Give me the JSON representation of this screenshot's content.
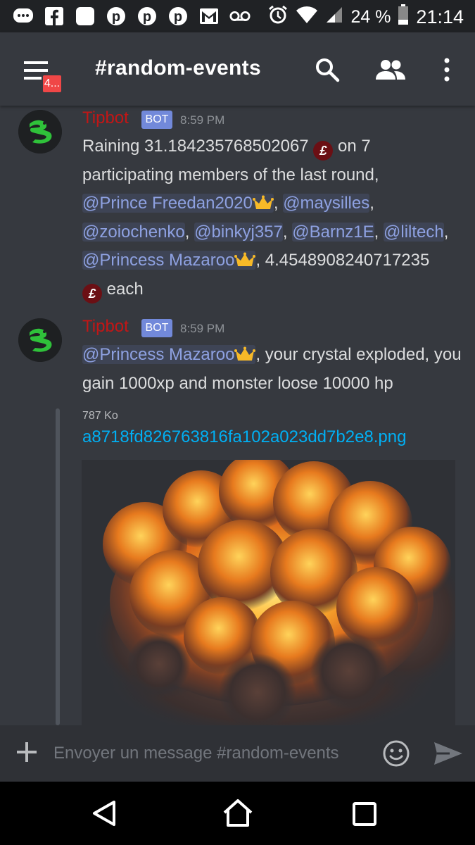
{
  "status_bar": {
    "battery": "24 %",
    "time": "21:14"
  },
  "app_bar": {
    "channel": "#random-events",
    "notification_badge": "4..."
  },
  "messages": [
    {
      "author": "Tipbot",
      "tag": "BOT",
      "time": "8:59 PM",
      "parts": {
        "p1": "Raining 31.184235768502067",
        "coin": "£",
        "p2": " on 7 participating members of the last round,",
        "m1": "@Prince Freedan2020",
        "c1": ",",
        "m2": "@maysilles",
        "c2": ",",
        "m3": "@zoiochenko",
        "c3": ",",
        "m4": "@binkyj357",
        "c4": ",",
        "m5": "@Barnz1E",
        "c5": ",",
        "m6": "@liltech",
        "c6": ",",
        "m7": "@Princess Mazaroo",
        "p3": ",  4.4548908240717235",
        "p4": " each"
      }
    },
    {
      "author": "Tipbot",
      "tag": "BOT",
      "time": "8:59 PM",
      "parts": {
        "m1": "@Princess Mazaroo",
        "p1": ", your crystal exploded, you gain 1000xp and monster loose 10000 hp"
      },
      "attachment": {
        "size": "787 Ko",
        "filename": "a8718fd826763816fa102a023dd7b2e8.png"
      }
    }
  ],
  "composer": {
    "placeholder": "Envoyer un message #random-events"
  },
  "colors": {
    "background": "#36393f",
    "bot_name": "#c21616",
    "bot_tag": "#7289da",
    "mention": "#8ea1e1",
    "link": "#00b0f4"
  }
}
